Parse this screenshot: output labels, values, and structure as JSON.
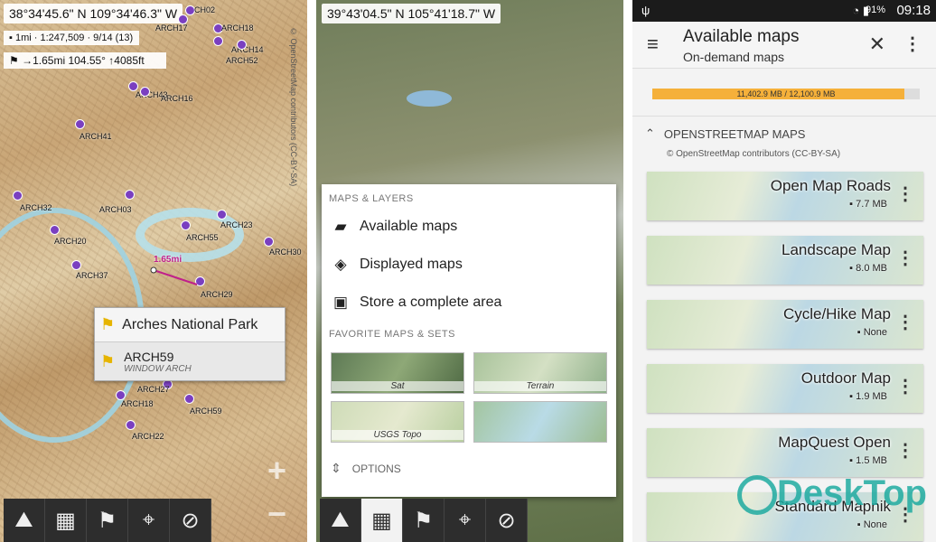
{
  "screen1": {
    "coords": "38°34'45.6\" N 109°34'46.3\" W",
    "scale": "1mi · 1:247,509 · 9/14 (13)",
    "route_info": "→1.65mi  104.55°  ↑4085ft",
    "distance_label": "1.65mi",
    "waypoints": [
      "CH02",
      "ARCH17",
      "ARCH18",
      "ARCH14",
      "ARCH52",
      "ARCH43",
      "ARCH16",
      "ARCH41",
      "ARCH32",
      "ARCH03",
      "ARCH20",
      "ARCH55",
      "ARCH23",
      "ARCH30",
      "ARCH37",
      "ARCH29",
      "ARCH27",
      "ARCH18",
      "ARCH59",
      "ARCH22"
    ],
    "callout_title": "Arches National Park",
    "callout_item_name": "ARCH59",
    "callout_item_sub": "WINDOW ARCH",
    "attribution": "© OpenStreetMap contributors (CC-BY-SA)"
  },
  "screen2": {
    "coords": "39°43'04.5\" N 105°41'18.7\" W",
    "section_maps": "MAPS & LAYERS",
    "item_available": "Available maps",
    "item_displayed": "Displayed maps",
    "item_store": "Store a complete area",
    "section_favorites": "FAVORITE MAPS & SETS",
    "favorites": [
      "Sat",
      "Terrain",
      "USGS Topo",
      ""
    ],
    "options": "OPTIONS"
  },
  "screen3": {
    "status_time": "09:18",
    "status_battery": "91%",
    "title": "Available maps",
    "subtitle": "On-demand maps",
    "storage_text": "11,402.9 MB / 12,100.9 MB",
    "storage_fraction": 0.942,
    "section_title": "OPENSTREETMAP MAPS",
    "section_attribution": "© OpenStreetMap contributors (CC-BY-SA)",
    "maps": [
      {
        "name": "Open Map Roads",
        "size": "7.7 MB"
      },
      {
        "name": "Landscape Map",
        "size": "8.0 MB"
      },
      {
        "name": "Cycle/Hike Map",
        "size": "None"
      },
      {
        "name": "Outdoor Map",
        "size": "1.9 MB"
      },
      {
        "name": "MapQuest Open",
        "size": "1.5 MB"
      },
      {
        "name": "Standard Mapnik",
        "size": "None"
      }
    ],
    "watermark": "DeskTop"
  },
  "colors": {
    "waypoint": "#7a3fc0",
    "storage_bar": "#f5b03a",
    "toolbar": "#2d2d2d"
  }
}
